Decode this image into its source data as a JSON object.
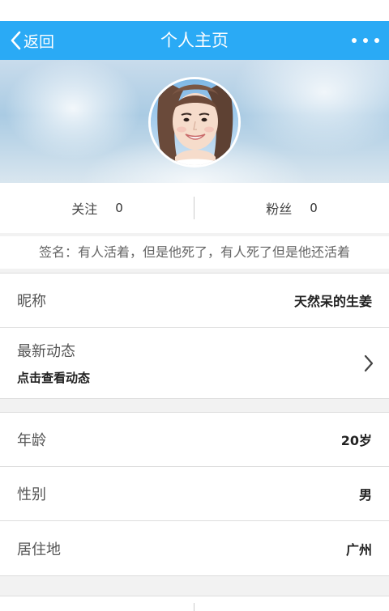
{
  "header": {
    "back_label": "返回",
    "title": "个人主页",
    "more_icon": "more-dots-icon",
    "back_icon": "chevron-left-icon",
    "color": "#2aaaf5"
  },
  "profile": {
    "avatar": "avatar-photo"
  },
  "stats": {
    "following_label": "关注",
    "following_count": "0",
    "fans_label": "粉丝",
    "fans_count": "0"
  },
  "signature": "签名：有人活着，但是他死了，有人死了但是他还活着",
  "details": {
    "nickname_label": "昵称",
    "nickname_value": "天然呆的生姜",
    "moments_label": "最新动态",
    "moments_hint": "点击查看动态",
    "moments_icon": "chevron-right-icon",
    "age_label": "年龄",
    "age_value": "20岁",
    "gender_label": "性别",
    "gender_value": "男",
    "location_label": "居住地",
    "location_value": "广州"
  }
}
